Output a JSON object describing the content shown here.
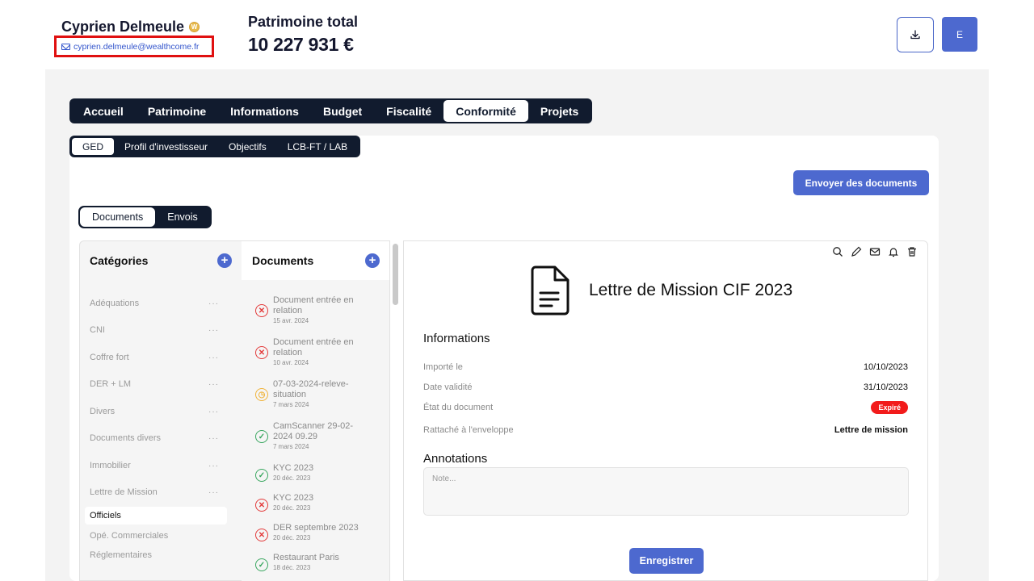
{
  "header": {
    "client_name": "Cyprien Delmeule",
    "badge": "W",
    "email": "cyprien.delmeule@wealthcome.fr",
    "patrimoine_label": "Patrimoine total",
    "patrimoine_value": "10 227 931 €",
    "user_initial": "E"
  },
  "main_tabs": [
    "Accueil",
    "Patrimoine",
    "Informations",
    "Budget",
    "Fiscalité",
    "Conformité",
    "Projets"
  ],
  "main_tab_active": "Conformité",
  "sub_tabs": [
    "GED",
    "Profil d'investisseur",
    "Objectifs",
    "LCB-FT / LAB"
  ],
  "sub_tab_active": "GED",
  "send_button": "Envoyer des documents",
  "toggle": [
    "Documents",
    "Envois"
  ],
  "categories": {
    "title": "Catégories",
    "items": [
      "Adéquations",
      "CNI",
      "Coffre fort",
      "DER + LM",
      "Divers",
      "Documents divers",
      "Immobilier",
      "Lettre de Mission"
    ],
    "selected": "Officiels",
    "subitems": [
      "Opé. Commerciales",
      "Réglementaires"
    ]
  },
  "documents": {
    "title": "Documents",
    "items": [
      {
        "name": "Document entrée en relation",
        "date": "15 avr. 2024",
        "status": "error"
      },
      {
        "name": "Document entrée en relation",
        "date": "10 avr. 2024",
        "status": "error"
      },
      {
        "name": "07-03-2024-releve-situation",
        "date": "7 mars 2024",
        "status": "pending"
      },
      {
        "name": "CamScanner 29-02-2024 09.29",
        "date": "7 mars 2024",
        "status": "valid"
      },
      {
        "name": "KYC 2023",
        "date": "20 déc. 2023",
        "status": "valid"
      },
      {
        "name": "KYC 2023",
        "date": "20 déc. 2023",
        "status": "error"
      },
      {
        "name": "DER septembre 2023",
        "date": "20 déc. 2023",
        "status": "error"
      },
      {
        "name": "Restaurant Paris",
        "date": "18 déc. 2023",
        "status": "valid"
      }
    ]
  },
  "detail": {
    "title": "Lettre de Mission CIF 2023",
    "info_heading": "Informations",
    "rows": [
      {
        "key": "Importé le",
        "value": "10/10/2023"
      },
      {
        "key": "Date validité",
        "value": "31/10/2023"
      },
      {
        "key": "État du document",
        "value": "Expiré"
      },
      {
        "key": "Rattaché à l'enveloppe",
        "value": "Lettre de mission"
      }
    ],
    "annotations_heading": "Annotations",
    "note_placeholder": "Note...",
    "save_button": "Enregistrer"
  },
  "colors": {
    "accent": "#4d69cf",
    "navy": "#111b2e",
    "error": "#e33a3a",
    "warning": "#f0b33a",
    "success": "#3aa760",
    "expired_badge": "#f21b1b"
  }
}
